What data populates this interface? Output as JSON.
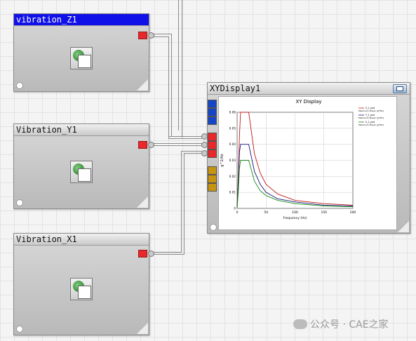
{
  "nodes": {
    "z1": {
      "title": "vibration_Z1"
    },
    "y1": {
      "title": "Vibration_Y1"
    },
    "x1": {
      "title": "Vibration_X1"
    }
  },
  "xy_display": {
    "title": "XYDisplay1"
  },
  "chart_data": {
    "type": "line",
    "title": "XY Display",
    "xlabel": "Frequency (Hz)",
    "ylabel": "g^2/Hz",
    "xlim": [
      0,
      200
    ],
    "ylim": [
      0,
      0.06
    ],
    "x_ticks": [
      "0",
      "50",
      "100",
      "150",
      "200"
    ],
    "y_ticks": [
      "0",
      "0.01",
      "0.02",
      "0.03",
      "0.04",
      "0.05",
      "0.06"
    ],
    "legend_position": "top-right",
    "grid": true,
    "series": [
      {
        "name": "Z_1_psd",
        "subtitle": "Maximum Power (g²/Hz)",
        "color": "#c01818",
        "x": [
          0,
          2,
          4,
          6,
          8,
          10,
          20,
          30,
          40,
          50,
          70,
          100,
          150,
          200
        ],
        "y": [
          0,
          0.02,
          0.045,
          0.06,
          0.06,
          0.06,
          0.06,
          0.034,
          0.022,
          0.015,
          0.009,
          0.005,
          0.003,
          0.002
        ]
      },
      {
        "name": "Y_1_psd",
        "subtitle": "Maximum Power (g²/Hz)",
        "color": "#14147a",
        "x": [
          0,
          2,
          4,
          6,
          10,
          20,
          30,
          40,
          50,
          70,
          100,
          150,
          200
        ],
        "y": [
          0,
          0.015,
          0.035,
          0.04,
          0.04,
          0.04,
          0.023,
          0.015,
          0.01,
          0.006,
          0.004,
          0.002,
          0.0015
        ]
      },
      {
        "name": "X_1_psd",
        "subtitle": "Maximum Power (g²/Hz)",
        "color": "#128a12",
        "x": [
          0,
          2,
          4,
          6,
          10,
          20,
          30,
          40,
          50,
          70,
          100,
          150,
          200
        ],
        "y": [
          0,
          0.01,
          0.025,
          0.03,
          0.03,
          0.03,
          0.017,
          0.011,
          0.008,
          0.005,
          0.003,
          0.0015,
          0.001
        ]
      }
    ]
  },
  "watermark": {
    "text": "公众号 · CAE之家"
  }
}
